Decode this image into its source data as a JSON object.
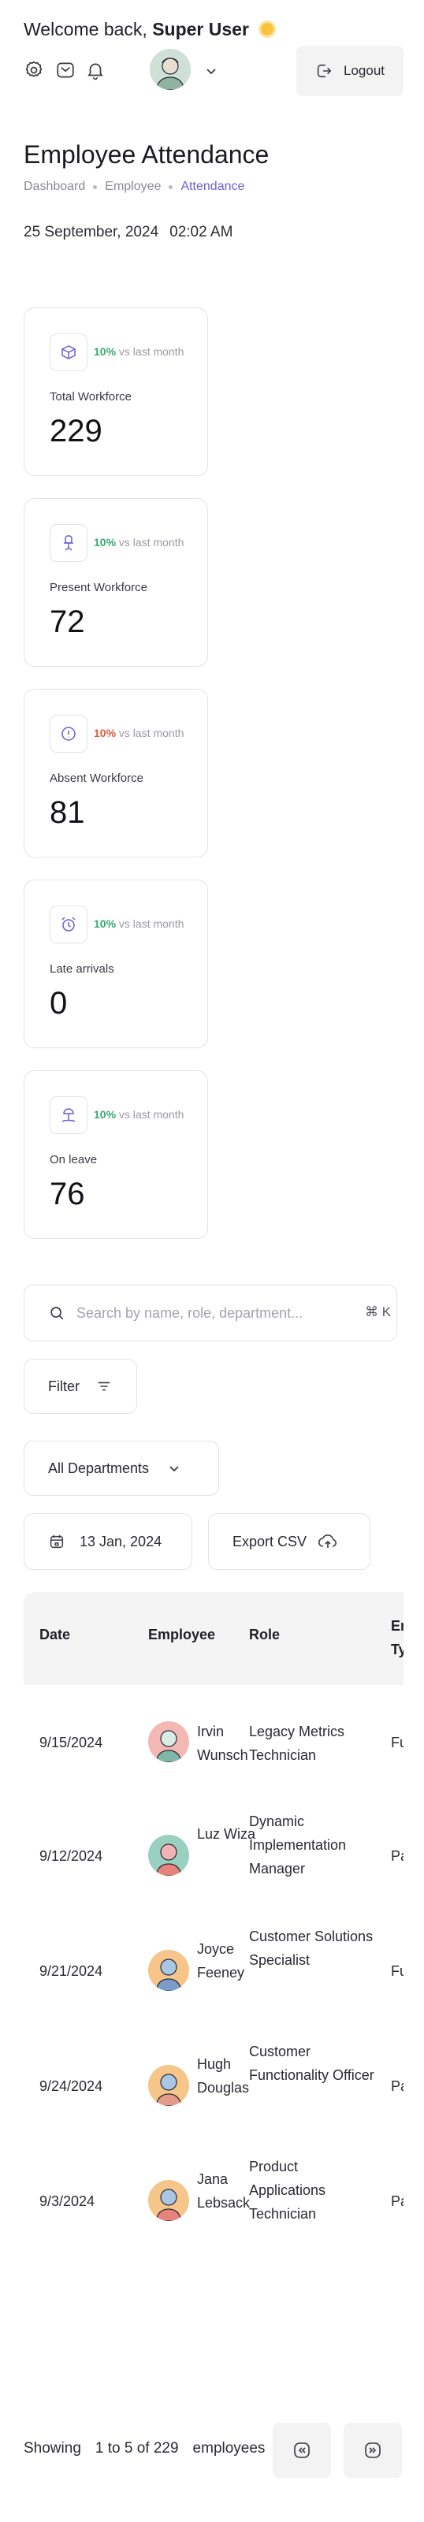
{
  "header": {
    "greeting_prefix": "Welcome back,",
    "user_name": "Super User",
    "logout_label": "Logout",
    "icons": [
      "settings-icon",
      "mail-icon",
      "bell-icon",
      "user-avatar",
      "chevron-down-icon",
      "logout-icon"
    ]
  },
  "page": {
    "title": "Employee Attendance",
    "breadcrumb": [
      "Dashboard",
      "Employee",
      "Attendance"
    ],
    "date": "25 September, 2024",
    "time": "02:02 AM"
  },
  "stats": [
    {
      "icon": "box-icon",
      "delta": "10%",
      "delta_suffix": "vs last month",
      "trend": "up",
      "label": "Total Workforce",
      "value": "229"
    },
    {
      "icon": "chair-icon",
      "delta": "10%",
      "delta_suffix": "vs last month",
      "trend": "up",
      "label": "Present Workforce",
      "value": "72"
    },
    {
      "icon": "alert-circle-icon",
      "delta": "10%",
      "delta_suffix": "vs last month",
      "trend": "down",
      "label": "Absent Workforce",
      "value": "81"
    },
    {
      "icon": "alarm-clock-icon",
      "delta": "10%",
      "delta_suffix": "vs last month",
      "trend": "up",
      "label": "Late arrivals",
      "value": "0"
    },
    {
      "icon": "beach-icon",
      "delta": "10%",
      "delta_suffix": "vs last month",
      "trend": "up",
      "label": "On leave",
      "value": "76"
    }
  ],
  "search": {
    "placeholder": "Search by name, role, department...",
    "shortcut": "⌘ K"
  },
  "filters": {
    "filter_label": "Filter",
    "department_value": "All Departments",
    "date_value": "13 Jan, 2024",
    "export_label": "Export CSV"
  },
  "table": {
    "headers": {
      "date": "Date",
      "employee": "Employee",
      "role": "Role",
      "type": "Em Ty"
    },
    "rows": [
      {
        "date": "9/15/2024",
        "employee": "Irvin Wunsch",
        "role": "Legacy Metrics Technician",
        "type": "Fu"
      },
      {
        "date": "9/12/2024",
        "employee": "Luz Wiza",
        "role": "Dynamic Implementation Manager",
        "type": "Pa"
      },
      {
        "date": "9/21/2024",
        "employee": "Joyce Feeney",
        "role": "Customer Solutions Specialist",
        "type": "Fu"
      },
      {
        "date": "9/24/2024",
        "employee": "Hugh Douglas",
        "role": "Customer Functionality Officer",
        "type": "Pa"
      },
      {
        "date": "9/3/2024",
        "employee": "Jana Lebsack",
        "role": "Product Applications Technician",
        "type": "Pa"
      }
    ]
  },
  "pagination": {
    "prefix": "Showing",
    "range": "1 to 5 of 229",
    "suffix": "employees"
  },
  "colors": {
    "accent": "#6b5fd4",
    "positive": "#3aa874",
    "negative": "#e0593e",
    "border": "#e3e3e8",
    "button_bg": "#f3f3f3"
  }
}
